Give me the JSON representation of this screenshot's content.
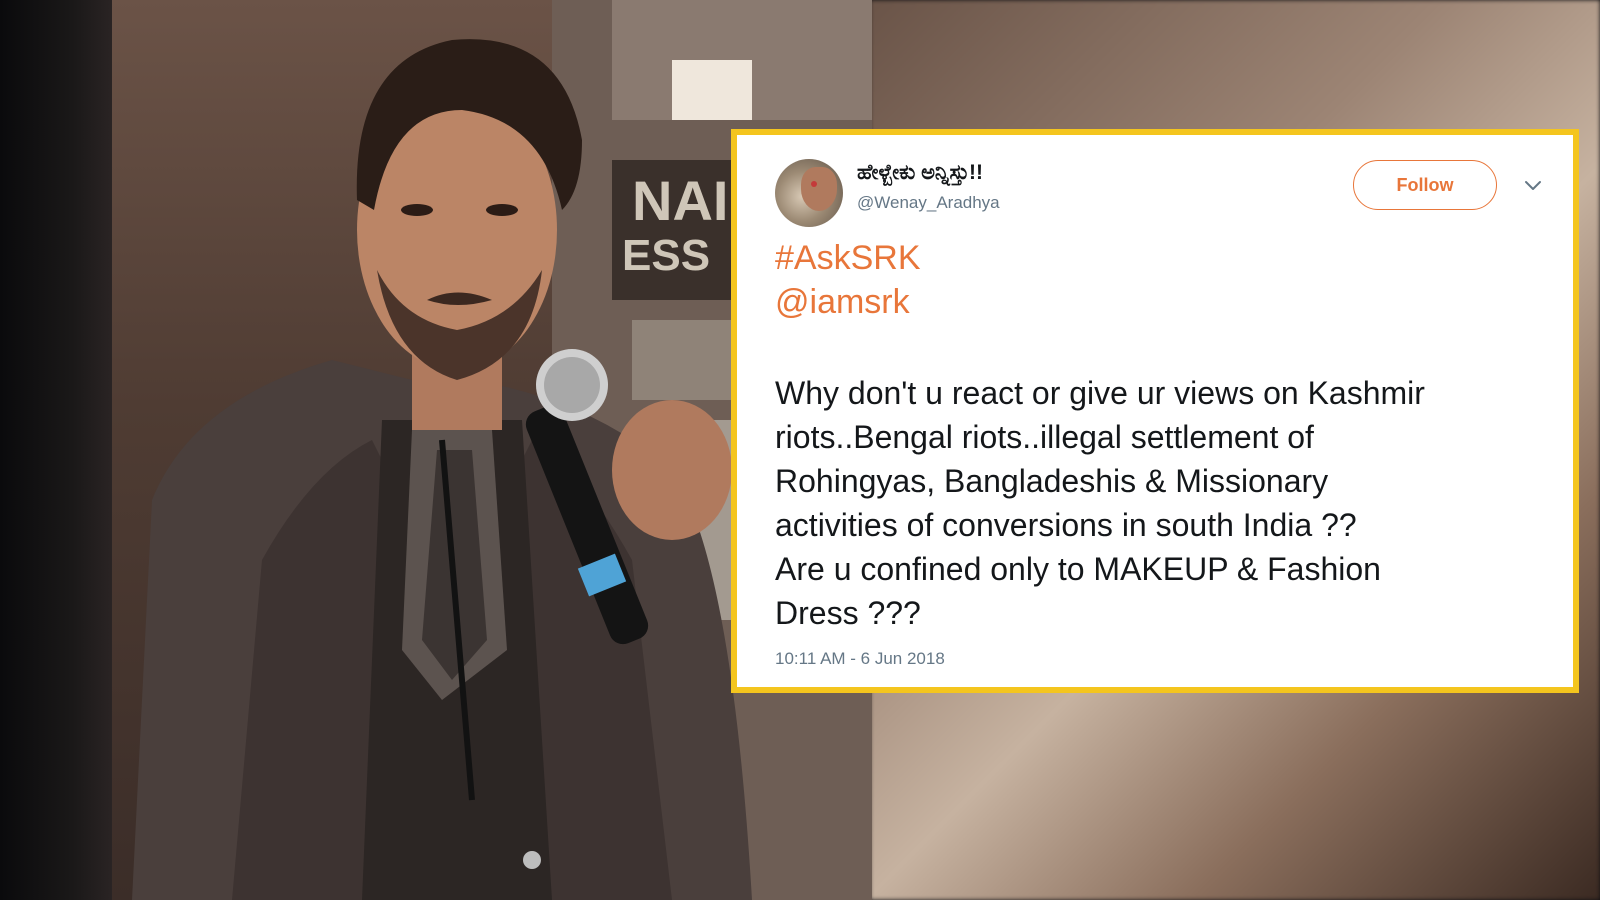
{
  "tweet": {
    "display_name": "ಹೇಳ್ಬೇಕು ಅನ್ನಿಸ್ತು!!",
    "handle": "@Wenay_Aradhya",
    "follow_label": "Follow",
    "hashtag": "#AskSRK",
    "mention": "@iamsrk",
    "body_lines": [
      "Why don't u react or give ur views on Kashmir",
      "riots..Bengal riots..illegal settlement of",
      "Rohingyas, Bangladeshis & Missionary",
      "activities of conversions in south India ??",
      "Are u confined only to MAKEUP & Fashion",
      "Dress ???"
    ],
    "timestamp": "10:11 AM - 6 Jun 2018",
    "accent_color": "#e8763a",
    "border_color": "#f4c51e"
  },
  "photo": {
    "backdrop_letters": [
      "NAI",
      "ESS"
    ]
  },
  "icons": {
    "more": "chevron-down-icon",
    "avatar": "avatar"
  }
}
